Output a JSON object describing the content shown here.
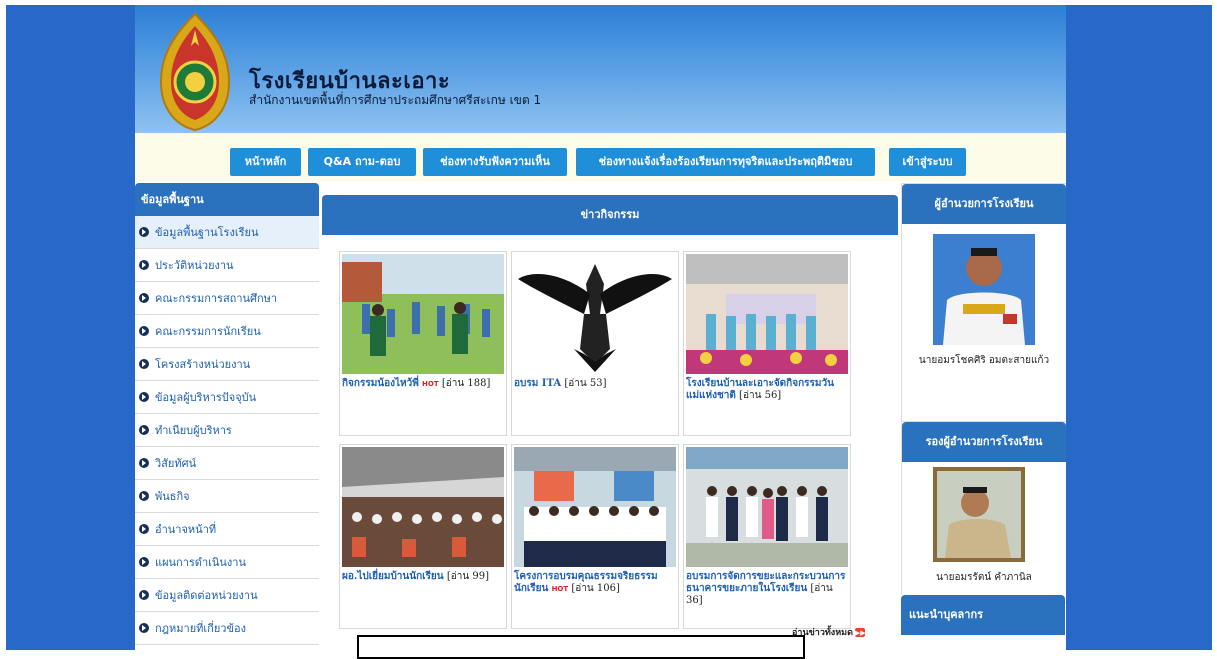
{
  "header": {
    "title": "โรงเรียนบ้านละเอาะ",
    "subtitle": "สำนักงานเขตพื้นที่การศึกษาประถมศึกษาศรีสะเกษ เขต 1"
  },
  "nav": {
    "items": [
      {
        "label": "หน้าหลัก"
      },
      {
        "label": "Q&A ถาม-ตอบ"
      },
      {
        "label": "ช่องทางรับฟังความเห็น"
      },
      {
        "label": "ช่องทางแจ้งเรื่องร้องเรียนการทุจริตและประพฤติมิชอบ"
      },
      {
        "label": "เข้าสู่ระบบ"
      }
    ]
  },
  "sidebar": {
    "heading": "ข้อมูลพื้นฐาน",
    "items": [
      {
        "label": "ข้อมูลพื้นฐานโรงเรียน"
      },
      {
        "label": "ประวัติหน่วยงาน"
      },
      {
        "label": "คณะกรรมการสถานศึกษา"
      },
      {
        "label": "คณะกรรมการนักเรียน"
      },
      {
        "label": "โครงสร้างหน่วยงาน"
      },
      {
        "label": "ข้อมูลผู้บริหารปัจจุบัน"
      },
      {
        "label": "ทำเนียบผู้บริหาร"
      },
      {
        "label": "วิสัยทัศน์"
      },
      {
        "label": "พันธกิจ"
      },
      {
        "label": "อำนาจหน้าที่"
      },
      {
        "label": "แผนการดำเนินงาน"
      },
      {
        "label": "ข้อมูลติดต่อหน่วยงาน"
      },
      {
        "label": "กฎหมายที่เกี่ยวข้อง"
      }
    ]
  },
  "news": {
    "heading": "ข่าวกิจกรรม",
    "hot_label": "HOT",
    "read_all": "อ่านข่าวทั้งหมด",
    "items": [
      {
        "title": "กิจกรรมน้องไหว้พี่",
        "hot": true,
        "reads": "[อ่าน 188]"
      },
      {
        "title": "อบรม ITA",
        "hot": false,
        "reads": "[อ่าน 53]"
      },
      {
        "title": "โรงเรียนบ้านละเอาะจัดกิจกรรมวันแม่แห่งชาติ",
        "hot": false,
        "reads": "[อ่าน 56]"
      },
      {
        "title": "ผอ.ไปเยี่ยมบ้านนักเรียน",
        "hot": false,
        "reads": "[อ่าน 99]"
      },
      {
        "title": "โครงการอบรมคุณธรรมจริยธรรมนักเรียน",
        "hot": true,
        "reads": "[อ่าน 106]"
      },
      {
        "title": "อบรมการจัดการขยะและกระบวนการธนาคารขยะภายในโรงเรียน",
        "hot": false,
        "reads": "[อ่าน 36]"
      }
    ]
  },
  "right": {
    "director_heading": "ผู้อำนวยการโรงเรียน",
    "director_name": "นายอมรโชคศิริ อมตะสายแก้ว",
    "deputy_heading": "รองผู้อำนวยการโรงเรียน",
    "deputy_name": "นายอมรรัตน์ คำภานิล",
    "staff_heading": "แนะนำบุคลากร"
  },
  "colors": {
    "frame": "#2868c8",
    "panel_head": "#2a72bd",
    "nav_button": "#1f8fd9",
    "hot": "#e02020"
  }
}
